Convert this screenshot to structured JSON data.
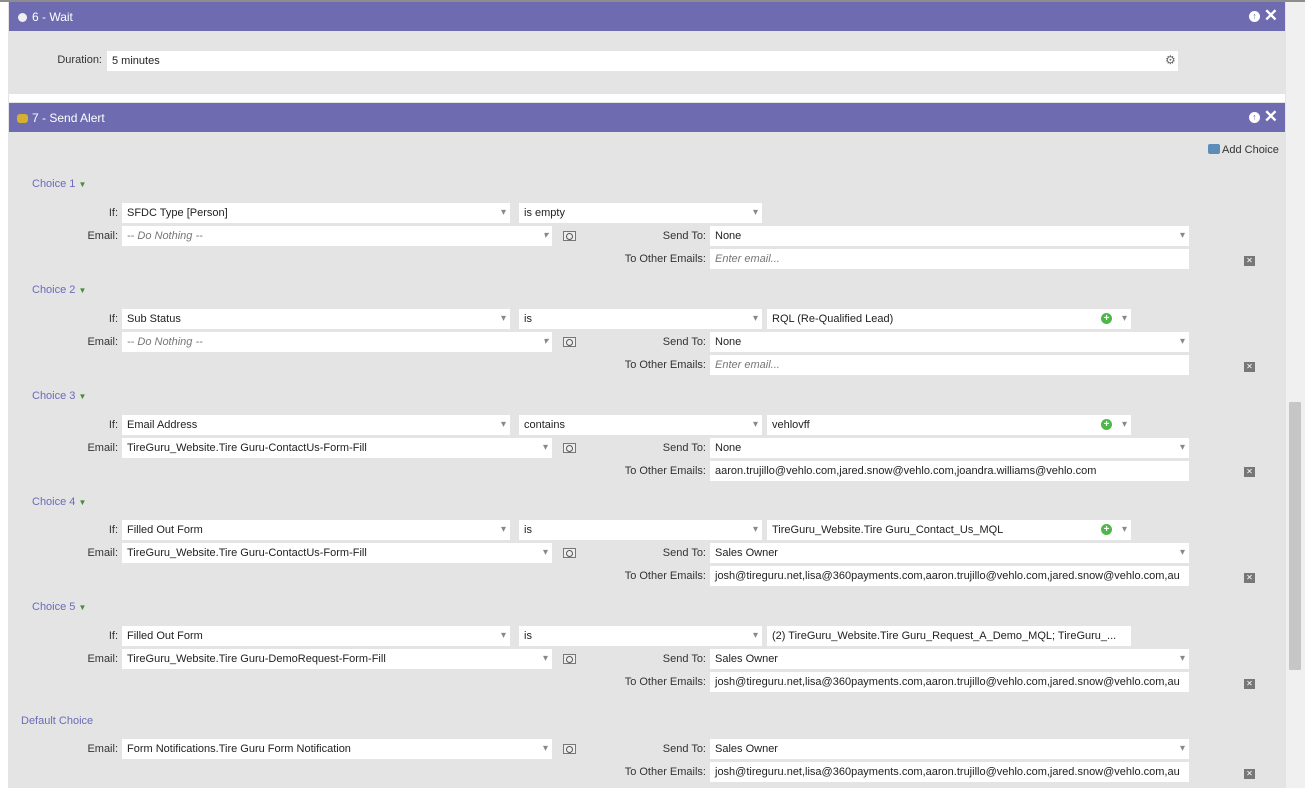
{
  "wait": {
    "title": "6 - Wait",
    "duration_label": "Duration:",
    "duration_value": "5 minutes"
  },
  "alert": {
    "title": "7 - Send Alert",
    "add_choice": "Add Choice",
    "labels": {
      "if": "If:",
      "email": "Email:",
      "send_to": "Send To:",
      "to_other": "To Other Emails:"
    },
    "choices": [
      {
        "label": "Choice 1",
        "if_field": "SFDC Type [Person]",
        "operator": "is empty",
        "value": "",
        "email": "-- Do Nothing --",
        "send_to": "None",
        "other_emails": "",
        "other_placeholder": "Enter email..."
      },
      {
        "label": "Choice 2",
        "if_field": "Sub Status",
        "operator": "is",
        "value": "RQL (Re-Qualified Lead)",
        "email": "-- Do Nothing --",
        "send_to": "None",
        "other_emails": "",
        "other_placeholder": "Enter email..."
      },
      {
        "label": "Choice 3",
        "if_field": "Email Address",
        "operator": "contains",
        "value": "vehlovff",
        "email": "TireGuru_Website.Tire Guru-ContactUs-Form-Fill",
        "send_to": "None",
        "other_emails": "aaron.trujillo@vehlo.com,jared.snow@vehlo.com,joandra.williams@vehlo.com"
      },
      {
        "label": "Choice 4",
        "if_field": "Filled Out Form",
        "operator": "is",
        "value": "TireGuru_Website.Tire Guru_Contact_Us_MQL",
        "email": "TireGuru_Website.Tire Guru-ContactUs-Form-Fill",
        "send_to": "Sales Owner",
        "other_emails": "josh@tireguru.net,lisa@360payments.com,aaron.trujillo@vehlo.com,jared.snow@vehlo.com,au"
      },
      {
        "label": "Choice 5",
        "if_field": "Filled Out Form",
        "operator": "is",
        "value": "(2) TireGuru_Website.Tire Guru_Request_A_Demo_MQL; TireGuru_...",
        "email": "TireGuru_Website.Tire Guru-DemoRequest-Form-Fill",
        "send_to": "Sales Owner",
        "other_emails": "josh@tireguru.net,lisa@360payments.com,aaron.trujillo@vehlo.com,jared.snow@vehlo.com,au"
      }
    ],
    "default": {
      "label": "Default Choice",
      "email": "Form Notifications.Tire Guru Form Notification",
      "send_to": "Sales Owner",
      "other_emails": "josh@tireguru.net,lisa@360payments.com,aaron.trujillo@vehlo.com,jared.snow@vehlo.com,au"
    }
  }
}
